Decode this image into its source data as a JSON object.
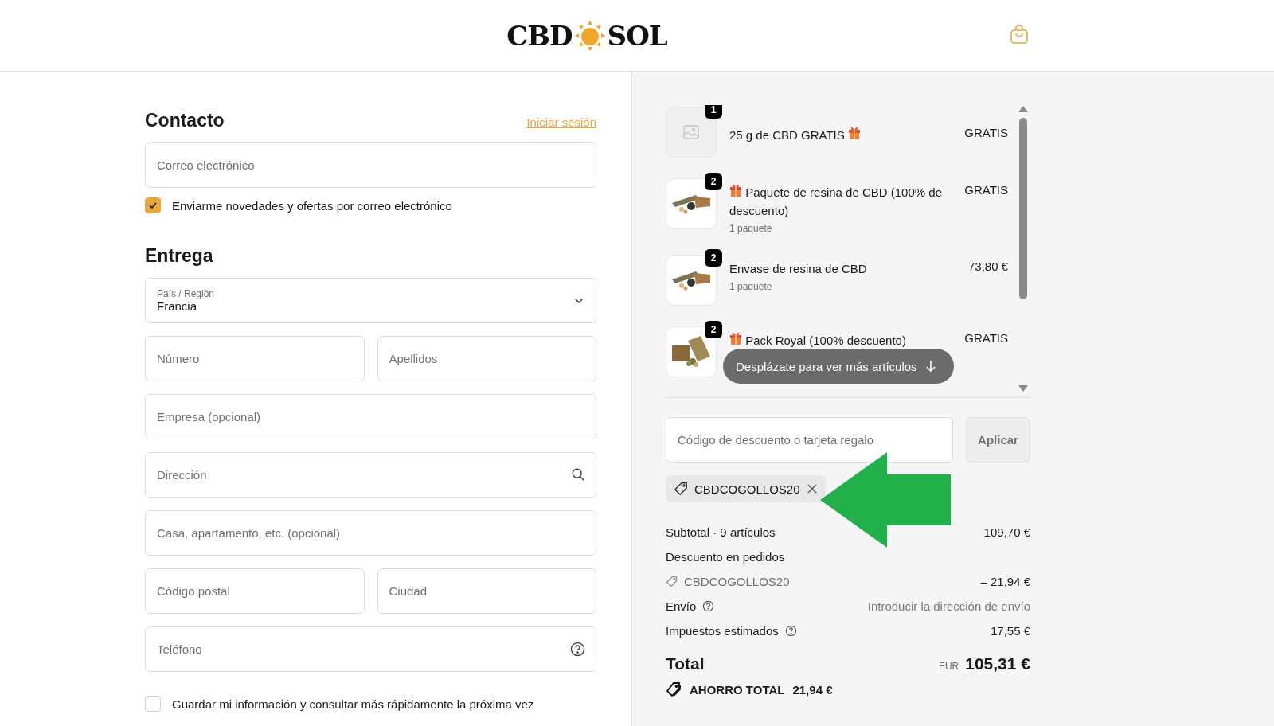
{
  "header": {
    "logo": {
      "left": "CBD",
      "right": "SOL"
    }
  },
  "contact": {
    "title": "Contacto",
    "login_link": "Iniciar sesión",
    "email": {
      "placeholder": "Correo electrónico"
    },
    "newsletter": {
      "label": "Enviarme novedades y ofertas por correo electrónico",
      "checked": true
    }
  },
  "delivery": {
    "title": "Entrega",
    "rows": [
      [
        {
          "kind": "select",
          "label": "País / Región",
          "value": "Francia"
        }
      ],
      [
        {
          "kind": "text",
          "placeholder": "Número"
        },
        {
          "kind": "text",
          "placeholder": "Apellidos"
        }
      ],
      [
        {
          "kind": "text",
          "placeholder": "Empresa (opcional)"
        }
      ],
      [
        {
          "kind": "address",
          "placeholder": "Dirección"
        }
      ],
      [
        {
          "kind": "text",
          "placeholder": "Casa, apartamento, etc. (opcional)"
        }
      ],
      [
        {
          "kind": "text",
          "placeholder": "Código postal"
        },
        {
          "kind": "text",
          "placeholder": "Ciudad"
        }
      ],
      [
        {
          "kind": "phone",
          "placeholder": "Teléfono"
        }
      ]
    ],
    "save_info": {
      "label": "Guardar mi información y consultar más rápidamente la próxima vez",
      "checked": false
    }
  },
  "order": {
    "items": [
      {
        "kind": "no-image",
        "quantity": "1",
        "name": "25 g de CBD GRATIS",
        "gift": true,
        "price": "GRATIS"
      },
      {
        "quantity": "2",
        "name": "Paquete de resina de CBD (100% de descuento)",
        "gift": true,
        "subtitle": "1 paquete",
        "price": "GRATIS"
      },
      {
        "quantity": "2",
        "name": "Envase de resina de CBD",
        "gift": false,
        "subtitle": "1 paquete",
        "price": "73,80 €"
      },
      {
        "quantity": "2",
        "name": "Pack Royal (100% descuento)",
        "gift": true,
        "price": "GRATIS"
      }
    ],
    "scroll_hint": "Desplázate para ver más artículos"
  },
  "discount": {
    "placeholder": "Código de descuento o tarjeta regalo",
    "button": "Aplicar",
    "applied": [
      {
        "code": "CBDCOGOLLOS20"
      }
    ]
  },
  "summary": {
    "rows": [
      {
        "kind": "line",
        "label": "Subtotal · 9 artículos",
        "value": "109,70 €"
      },
      {
        "kind": "line",
        "label": "Descuento en pedidos"
      },
      {
        "kind": "code",
        "label": "CBDCOGOLLOS20",
        "value": "– 21,94 €"
      },
      {
        "kind": "line",
        "label": "Envío",
        "help": true,
        "value": "Introducir la dirección de envío",
        "muted": true
      },
      {
        "kind": "line",
        "label": "Impuestos estimados",
        "help": true,
        "value": "17,55 €"
      }
    ],
    "total": {
      "label": "Total",
      "currency": "EUR",
      "value": "105,31 €"
    },
    "savings": {
      "label": "AHORRO TOTAL",
      "value": "21,94 €"
    }
  }
}
